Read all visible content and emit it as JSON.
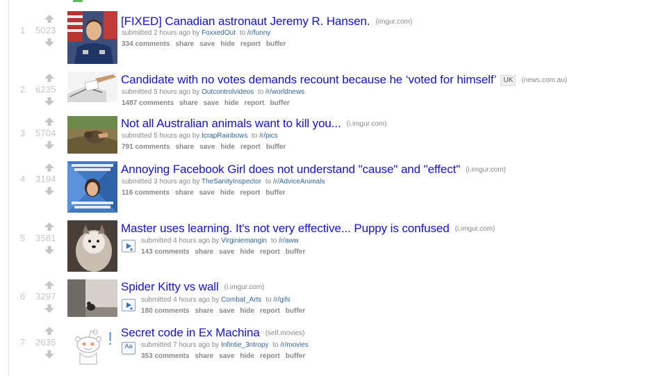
{
  "posts": [
    {
      "rank": "1",
      "score": "5023",
      "title": "[FIXED] Canadian astronaut Jeremy R. Hansen.",
      "flair": "",
      "domain": "(imgur.com)",
      "submitted": "submitted 2 hours ago by",
      "author": "FoxxedOut",
      "to": "to",
      "subreddit": "/r/funny",
      "comments": "334 comments",
      "thumbnail": "astronaut-photo",
      "expando": ""
    },
    {
      "rank": "2",
      "score": "6235",
      "title": "Candidate with no votes demands recount because he ‘voted for himself’",
      "flair": "UK",
      "domain": "(news.com.au)",
      "submitted": "submitted 5 hours ago by",
      "author": "Outcontrolvideos",
      "to": "to",
      "subreddit": "/r/worldnews",
      "comments": "1487 comments",
      "thumbnail": "ballot-box-photo",
      "expando": ""
    },
    {
      "rank": "3",
      "score": "5704",
      "title": "Not all Australian animals want to kill you...",
      "flair": "",
      "domain": "(i.imgur.com)",
      "submitted": "submitted 5 hours ago by",
      "author": "IcrapRainbows",
      "to": "to",
      "subreddit": "/r/pics",
      "comments": "791 comments",
      "thumbnail": "animal-photo",
      "expando": ""
    },
    {
      "rank": "4",
      "score": "3194",
      "title": "Annoying Facebook Girl does not understand \"cause\" and \"effect\"",
      "flair": "",
      "domain": "(i.imgur.com)",
      "submitted": "submitted 3 hours ago by",
      "author": "TheSanityInspector",
      "to": "to",
      "subreddit": "/r/AdviceAnimals",
      "comments": "116 comments",
      "thumbnail": "meme-image",
      "expando": ""
    },
    {
      "rank": "5",
      "score": "3581",
      "title": "Master uses learning. It's not very effective... Puppy is confused",
      "flair": "",
      "domain": "(i.imgur.com)",
      "submitted": "submitted 4 hours ago by",
      "author": "Virginiemangin",
      "to": "to",
      "subreddit": "/r/aww",
      "comments": "143 comments",
      "thumbnail": "puppy-photo",
      "expando": "video-expando-icon"
    },
    {
      "rank": "6",
      "score": "3297",
      "title": "Spider Kitty vs wall",
      "flair": "",
      "domain": "(i.imgur.com)",
      "submitted": "submitted 4 hours ago by",
      "author": "Combat_Arts",
      "to": "to",
      "subreddit": "/r/gifs",
      "comments": "180 comments",
      "thumbnail": "cat-photo",
      "expando": "video-expando-icon"
    },
    {
      "rank": "7",
      "score": "2635",
      "title": "Secret code in Ex Machina",
      "flair": "",
      "domain": "(self.movies)",
      "submitted": "submitted 7 hours ago by",
      "author": "Infintie_3ntropy",
      "to": "to",
      "subreddit": "/r/movies",
      "comments": "353 comments",
      "thumbnail": "reddit-alien-self-thumbnail",
      "expando": "text-expando-icon",
      "expando_text": "Aa"
    }
  ],
  "buttons": {
    "share": "share",
    "save": "save",
    "hide": "hide",
    "report": "report",
    "buffer": "buffer"
  },
  "self_thumbnail_mark": "!",
  "colors": {
    "title_link": "#1111dd",
    "meta_link": "#336699",
    "muted": "#888888",
    "score": "#c6c6c6",
    "accent": "#5cb85c"
  }
}
